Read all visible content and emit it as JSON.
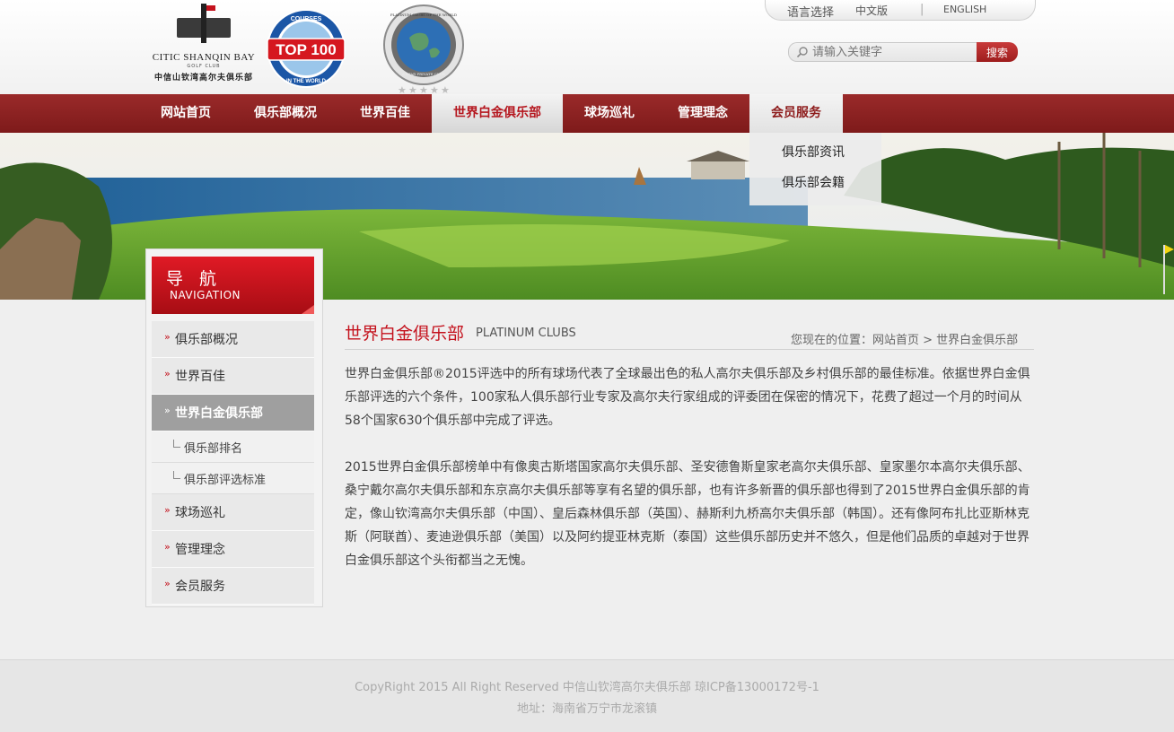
{
  "header": {
    "logo": {
      "name": "CITIC SHANQIN BAY",
      "sub": "GOLF CLUB",
      "cn": "中信山钦湾高尔夫俱乐部"
    },
    "badges": {
      "top100": {
        "top_text": "COURSES",
        "main_text": "TOP 100",
        "bottom_text": "IN THE WORLD"
      },
      "platinum": {
        "ring_text": "PLATINUM CLUBS OF THE WORLD",
        "bottom_text": "5 STAR PRIVATE CLUB",
        "stars": 5
      }
    },
    "language": {
      "label": "语言选择",
      "cn": "中文版",
      "separator": "|",
      "en": "ENGLISH"
    },
    "search": {
      "placeholder": "请输入关键字",
      "button": "搜索"
    }
  },
  "nav": {
    "items": [
      {
        "label": "网站首页"
      },
      {
        "label": "俱乐部概况"
      },
      {
        "label": "世界百佳"
      },
      {
        "label": "世界白金俱乐部"
      },
      {
        "label": "球场巡礼"
      },
      {
        "label": "管理理念"
      },
      {
        "label": "会员服务"
      }
    ],
    "dropdown": [
      "俱乐部资讯",
      "俱乐部会籍"
    ]
  },
  "sidebar": {
    "title_cn": "导 航",
    "title_en": "NAVIGATION",
    "items": [
      {
        "label": "俱乐部概况"
      },
      {
        "label": "世界百佳"
      },
      {
        "label": "世界白金俱乐部"
      },
      {
        "label": "俱乐部排名"
      },
      {
        "label": "俱乐部评选标准"
      },
      {
        "label": "球场巡礼"
      },
      {
        "label": "管理理念"
      },
      {
        "label": "会员服务"
      }
    ]
  },
  "content": {
    "title": "世界白金俱乐部",
    "title_en": "PLATINUM CLUBS",
    "breadcrumb": "您现在的位置：网站首页 > 世界白金俱乐部",
    "paragraphs": [
      "世界白金俱乐部®2015评选中的所有球场代表了全球最出色的私人高尔夫俱乐部及乡村俱乐部的最佳标准。依据世界白金俱乐部评选的六个条件，100家私人俱乐部行业专家及高尔夫行家组成的评委团在保密的情况下，花费了超过一个月的时间从58个国家630个俱乐部中完成了评选。",
      "2015世界白金俱乐部榜单中有像奥古斯塔国家高尔夫俱乐部、圣安德鲁斯皇家老高尔夫俱乐部、皇家墨尔本高尔夫俱乐部、桑宁戴尔高尔夫俱乐部和东京高尔夫俱乐部等享有名望的俱乐部，也有许多新晋的俱乐部也得到了2015世界白金俱乐部的肯定，像山钦湾高尔夫俱乐部（中国）、皇后森林俱乐部（英国）、赫斯利九桥高尔夫俱乐部（韩国）。还有像阿布扎比亚斯林克斯（阿联酋）、麦迪逊俱乐部（美国）以及阿约提亚林克斯（泰国）这些俱乐部历史并不悠久，但是他们品质的卓越对于世界白金俱乐部这个头衔都当之无愧。"
    ]
  },
  "footer": {
    "copyright": "CopyRight 2015 All Right Reserved 中信山钦湾高尔夫俱乐部 琼ICP备13000172号-1",
    "address": "地址：海南省万宁市龙滚镇"
  },
  "colors": {
    "brand_red": "#c4121d",
    "nav_bg": "#8d2424",
    "sidebar_active": "#9f9f9f"
  }
}
